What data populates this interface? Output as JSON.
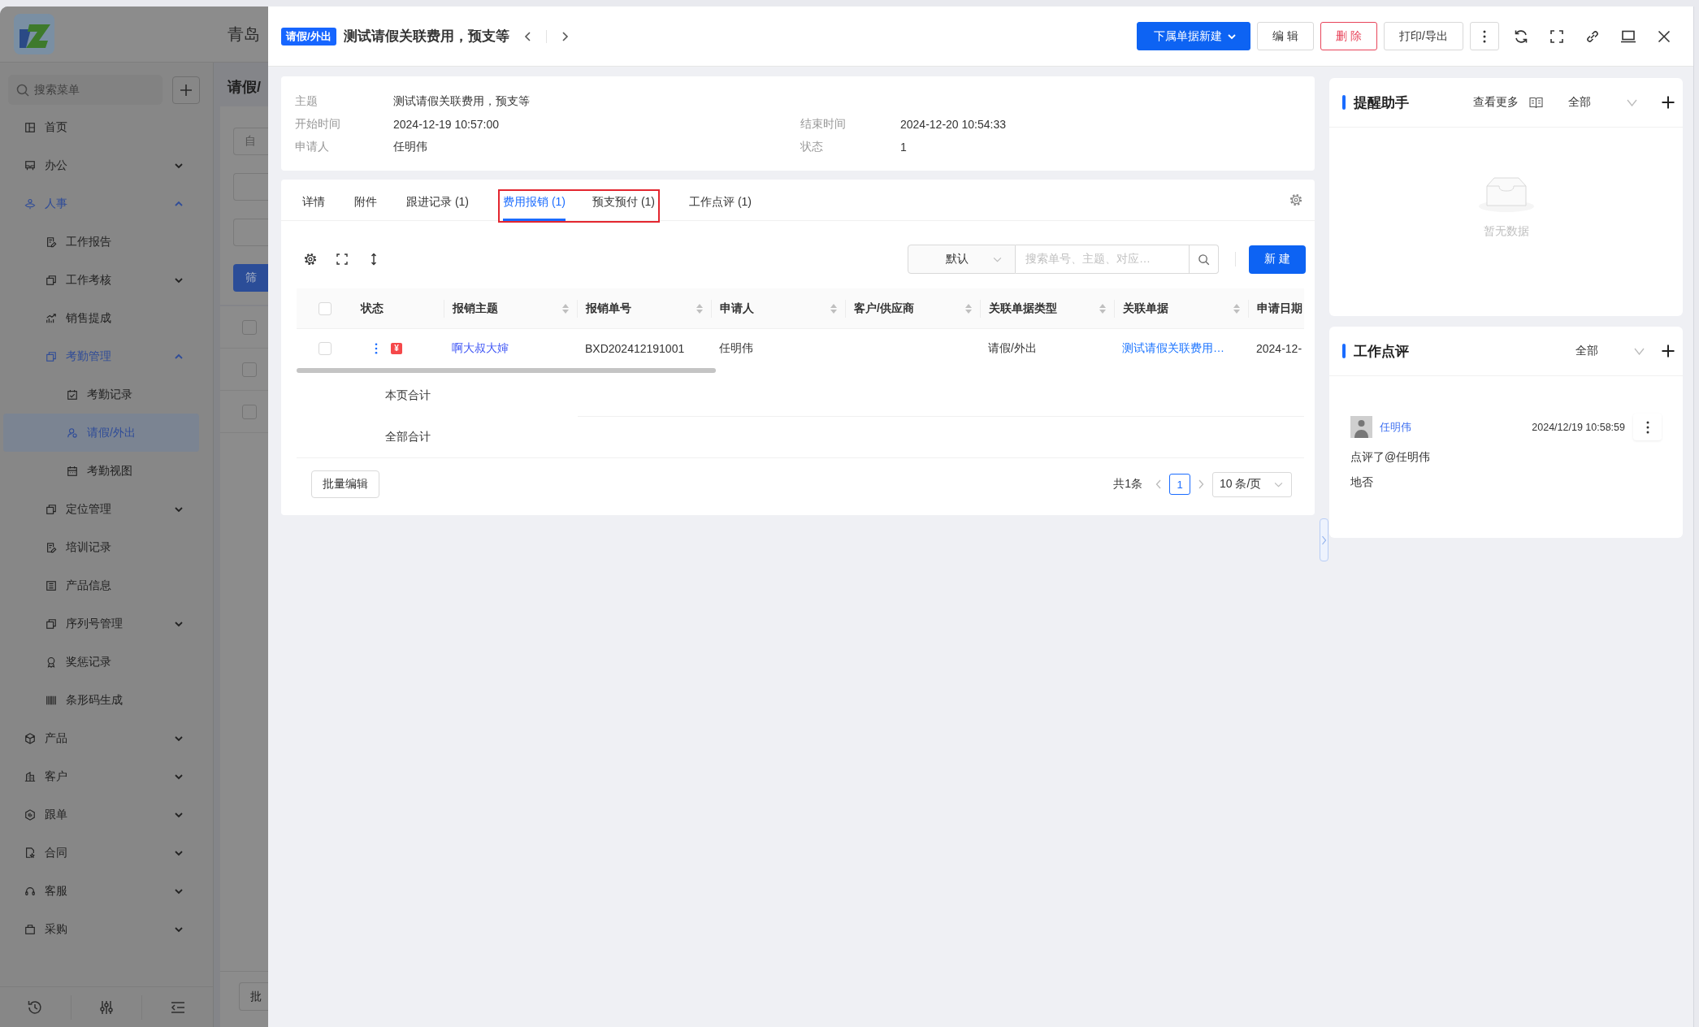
{
  "background_app": {
    "company_name": "青岛",
    "menu_search": {
      "placeholder": "搜索菜单"
    },
    "menu": [
      {
        "label": "首页",
        "selected": false
      },
      {
        "label": "办公",
        "selected": false,
        "expanded": false
      },
      {
        "label": "人事",
        "selected": false,
        "expanded": true,
        "children": [
          {
            "label": "工作报告",
            "selected": false
          },
          {
            "label": "工作考核",
            "selected": false,
            "expanded": false
          },
          {
            "label": "销售提成",
            "selected": false
          },
          {
            "label": "考勤管理",
            "selected": false,
            "expanded": true,
            "children": [
              {
                "label": "考勤记录",
                "selected": false
              },
              {
                "label": "请假/外出",
                "selected": true
              },
              {
                "label": "考勤视图",
                "selected": false
              }
            ]
          },
          {
            "label": "定位管理",
            "selected": false,
            "expanded": false
          },
          {
            "label": "培训记录",
            "selected": false
          },
          {
            "label": "产品信息",
            "selected": false
          },
          {
            "label": "序列号管理",
            "selected": false,
            "expanded": false
          },
          {
            "label": "奖惩记录",
            "selected": false
          },
          {
            "label": "条形码生成",
            "selected": false
          }
        ]
      },
      {
        "label": "产品",
        "selected": false,
        "expanded": false
      },
      {
        "label": "客户",
        "selected": false,
        "expanded": false
      },
      {
        "label": "跟单",
        "selected": false,
        "expanded": false
      },
      {
        "label": "合同",
        "selected": false,
        "expanded": false
      },
      {
        "label": "客服",
        "selected": false,
        "expanded": false
      },
      {
        "label": "采购",
        "selected": false,
        "expanded": false
      }
    ],
    "page_title": "请假/",
    "filter_field": {
      "placeholder": "自"
    },
    "filter_button": "筛",
    "rows": [
      {
        "checked": false
      },
      {
        "checked": false
      },
      {
        "checked": false
      }
    ],
    "batch_button": "批"
  },
  "drawer": {
    "badge": "请假/外出",
    "title": "测试请假关联费用，预支等",
    "actions": [
      {
        "label": "下属单据新建",
        "kind": "primary"
      },
      {
        "label": "编 辑",
        "kind": "default"
      },
      {
        "label": "删 除",
        "kind": "danger"
      },
      {
        "label": "打印/导出",
        "kind": "default"
      }
    ],
    "info": [
      [
        {
          "label": "主题",
          "value": "测试请假关联费用，预支等"
        }
      ],
      [
        {
          "label": "开始时间",
          "value": "2024-12-19 10:57:00"
        },
        {
          "label": "结束时间",
          "value": "2024-12-20 10:54:33"
        }
      ],
      [
        {
          "label": "申请人",
          "value": "任明伟"
        },
        {
          "label": "状态",
          "value": "1"
        }
      ]
    ],
    "tabs": [
      {
        "label": "详情",
        "selected": false,
        "highlighted": false
      },
      {
        "label": "附件",
        "selected": false,
        "highlighted": false
      },
      {
        "label": "跟进记录 (1)",
        "selected": false,
        "highlighted": false
      },
      {
        "label": "费用报销 (1)",
        "selected": true,
        "highlighted": true
      },
      {
        "label": "预支预付 (1)",
        "selected": false,
        "highlighted": true
      },
      {
        "label": "工作点评 (1)",
        "selected": false,
        "highlighted": false
      }
    ],
    "toolbar": {
      "sort_select": "默认",
      "search": {
        "placeholder": "搜索单号、主题、对应…"
      },
      "new_button": "新 建"
    },
    "table": {
      "header_checked": false,
      "columns": [
        {
          "label": "状态",
          "sortable": false
        },
        {
          "label": "报销主题",
          "sortable": true
        },
        {
          "label": "报销单号",
          "sortable": true
        },
        {
          "label": "申请人",
          "sortable": true
        },
        {
          "label": "客户/供应商",
          "sortable": true
        },
        {
          "label": "关联单据类型",
          "sortable": true
        },
        {
          "label": "关联单据",
          "sortable": true
        },
        {
          "label": "申请日期",
          "sortable": false
        }
      ],
      "rows": [
        {
          "checked": false,
          "status_badge": "¥",
          "subject": "啊大叔大婶",
          "number": "BXD202412191001",
          "applicant": "任明伟",
          "related_type": "请假/外出",
          "related_doc": "测试请假关联费用…",
          "date": "2024-12-"
        }
      ],
      "summary_rows": [
        "本页合计",
        "全部合计"
      ]
    },
    "footer": {
      "batch_button": "批量编辑",
      "total": "共1条",
      "pages": [
        {
          "label": "1",
          "selected": true
        }
      ],
      "page_size": "10 条/页"
    }
  },
  "side_panels": {
    "reminders": {
      "title": "提醒助手",
      "more_link": "查看更多",
      "filter": "全部",
      "empty_text": "暂无数据"
    },
    "reviews": {
      "title": "工作点评",
      "filter": "全部",
      "comments": [
        {
          "author": "任明伟",
          "time": "2024/12/19 10:58:59",
          "lines": [
            "点评了@任明伟",
            "地否"
          ]
        }
      ]
    }
  }
}
